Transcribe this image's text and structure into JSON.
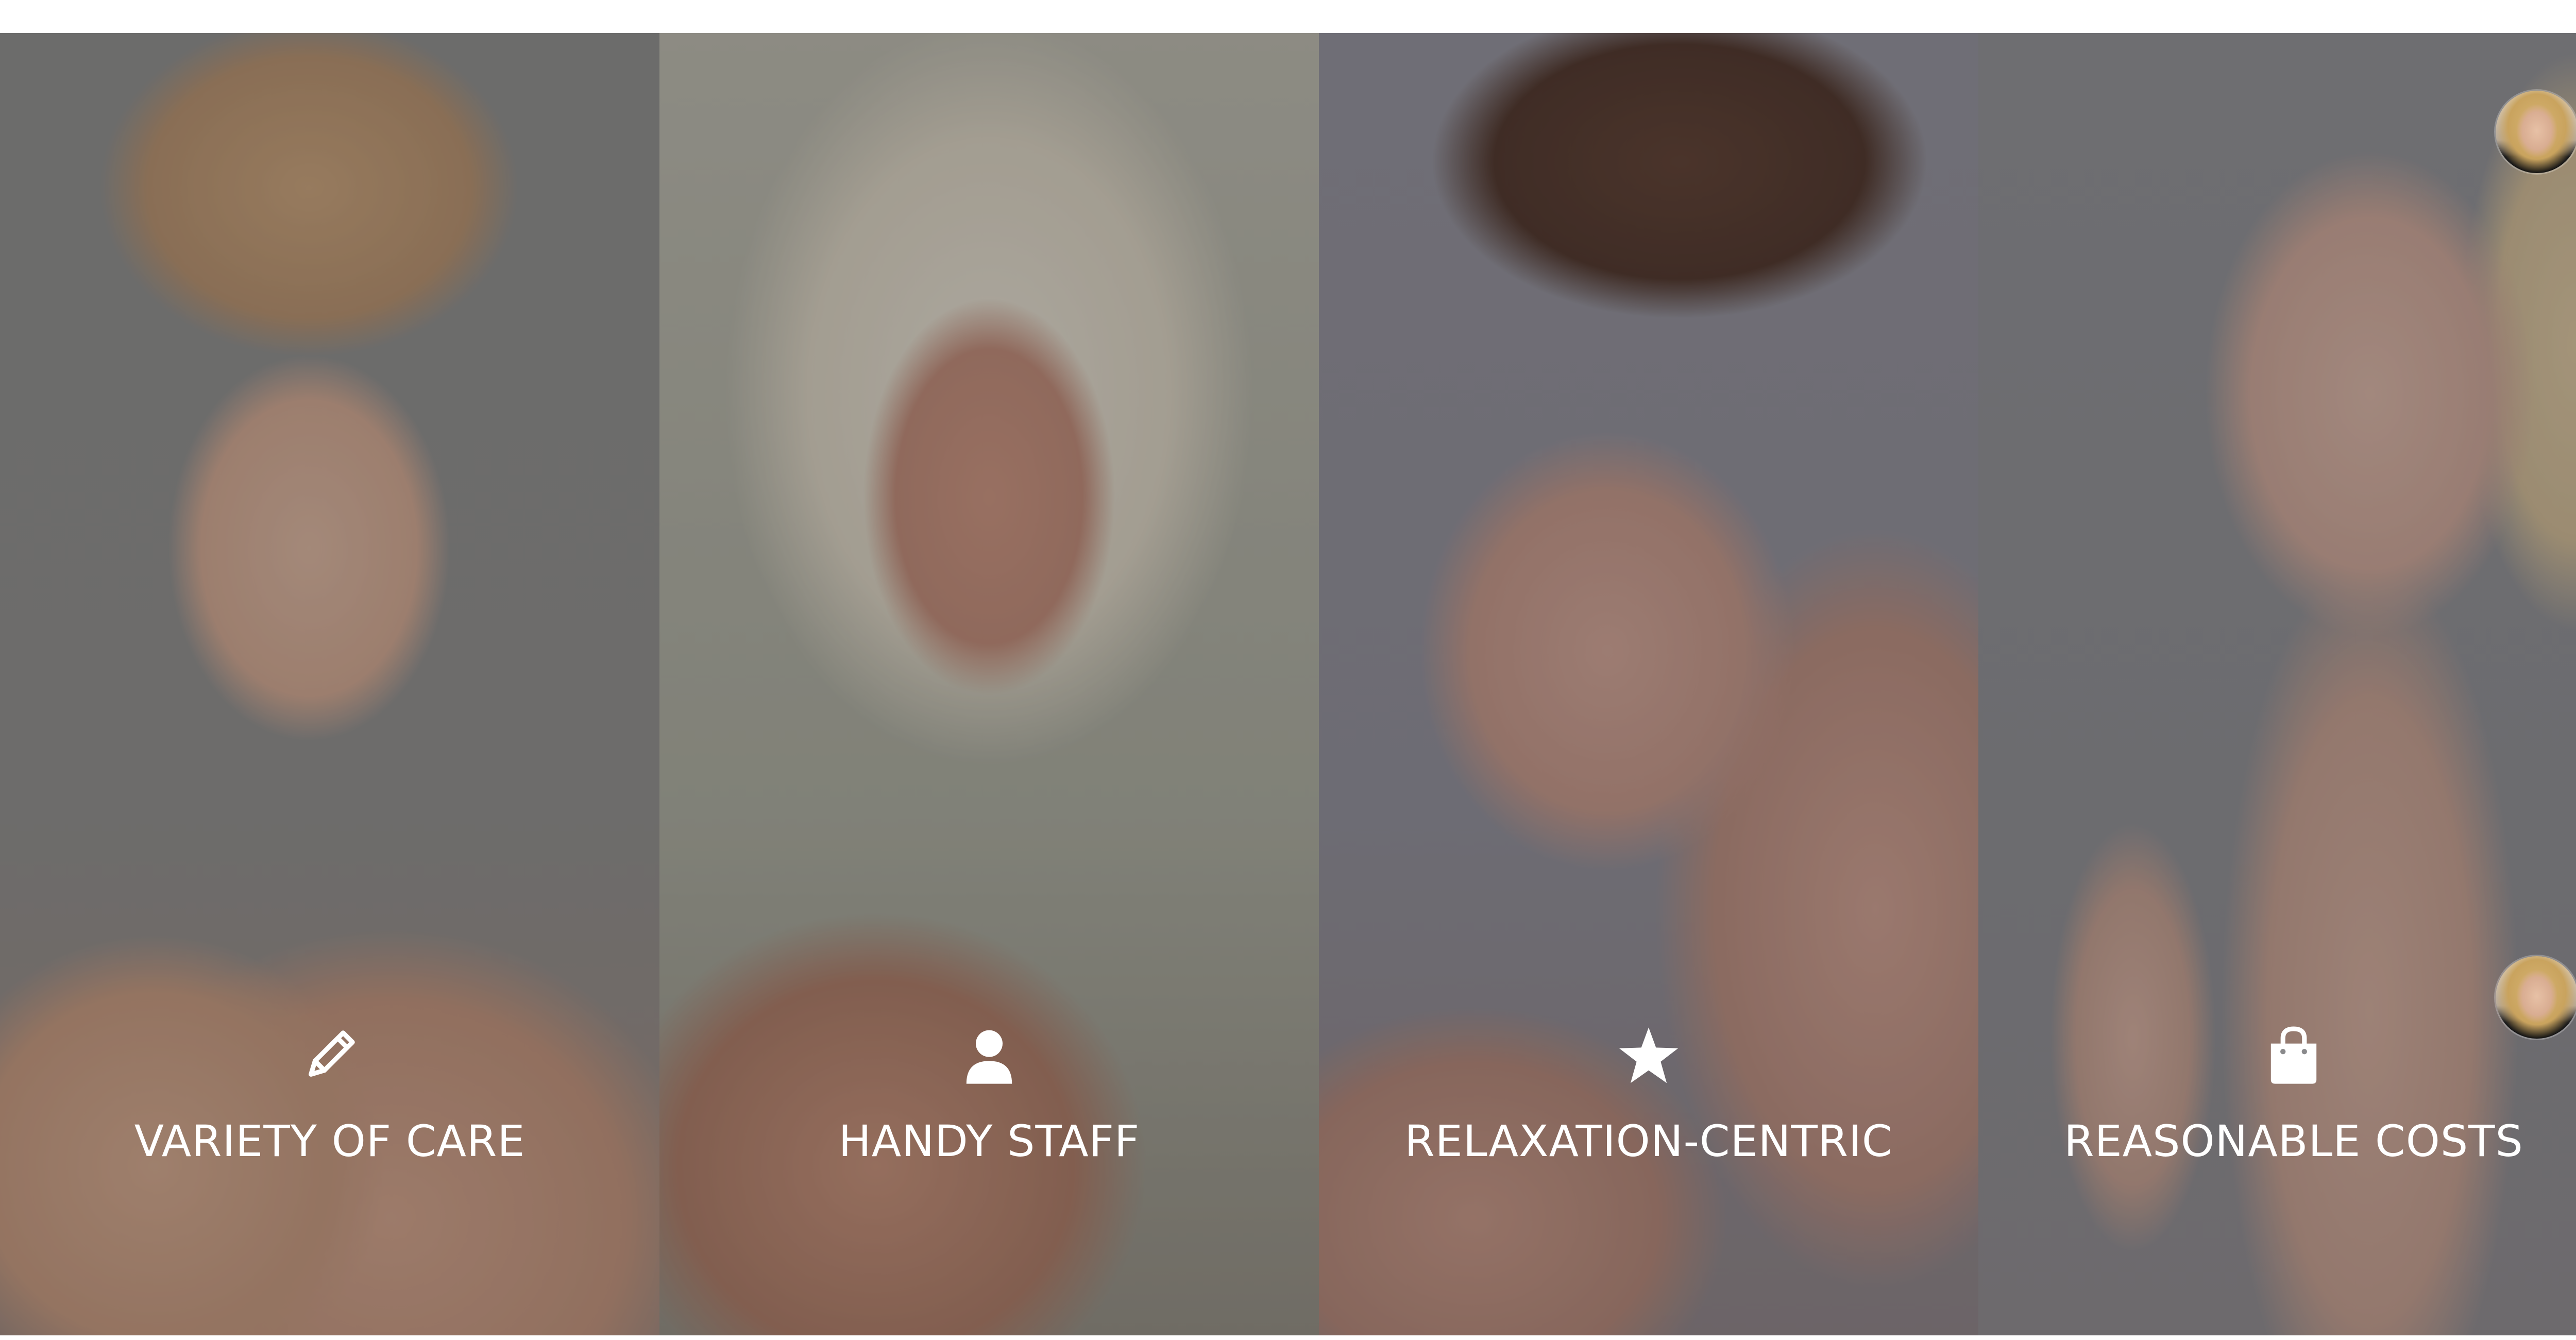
{
  "features": [
    {
      "label": "VARIETY OF CARE",
      "icon": "pencil-icon"
    },
    {
      "label": "HANDY STAFF",
      "icon": "user-icon"
    },
    {
      "label": "RELAXATION-CENTRIC",
      "icon": "star-icon"
    },
    {
      "label": "REASONABLE COSTS",
      "icon": "shopping-bag-icon"
    }
  ],
  "colors": {
    "text": "#ffffff",
    "overlay": "rgba(40,40,45,0.30)",
    "background": "#ffffff"
  }
}
